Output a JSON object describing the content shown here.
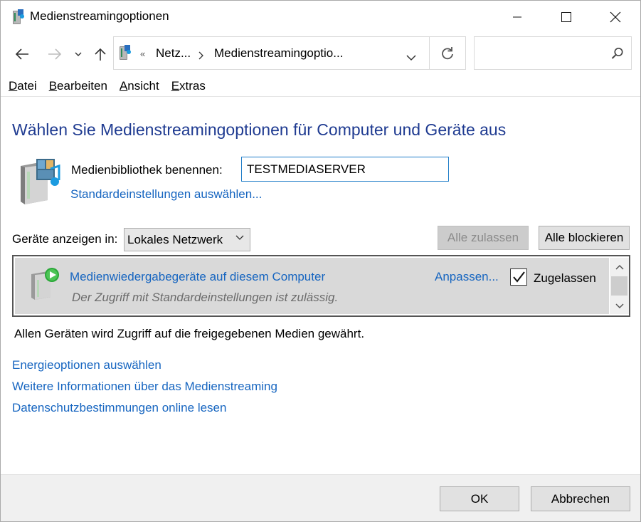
{
  "window": {
    "title": "Medienstreamingoptionen",
    "minimize_icon": "minimize-icon",
    "maximize_icon": "maximize-icon",
    "close_icon": "close-icon"
  },
  "address_bar": {
    "back_icon": "back-arrow-icon",
    "forward_icon": "forward-arrow-icon",
    "up_icon": "up-arrow-icon",
    "overflow": "«",
    "crumbs": [
      "Netz...",
      "Medienstreamingoptio..."
    ],
    "search_placeholder": ""
  },
  "menu": {
    "items": [
      {
        "accel": "D",
        "rest": "atei"
      },
      {
        "accel": "B",
        "rest": "earbeiten"
      },
      {
        "accel": "A",
        "rest": "nsicht"
      },
      {
        "accel": "E",
        "rest": "xtras"
      }
    ]
  },
  "heading": "Wählen Sie Medienstreamingoptionen für Computer und Geräte aus",
  "library": {
    "label": "Medienbibliothek benennen:",
    "value": "TESTMEDIASERVER",
    "defaults_link": "Standardeinstellungen auswählen..."
  },
  "devices": {
    "show_label": "Geräte anzeigen in:",
    "selected_network": "Lokales Netzwerk",
    "allow_all": "Alle zulassen",
    "block_all": "Alle blockieren",
    "rows": [
      {
        "title": "Medienwiedergabegeräte auf diesem Computer",
        "description": "Der Zugriff mit Standardeinstellungen ist zulässig.",
        "customize": "Anpassen...",
        "allowed_label": "Zugelassen",
        "allowed": true
      }
    ]
  },
  "info_text": "Allen Geräten wird Zugriff auf die freigegebenen Medien gewährt.",
  "links": {
    "power": "Energieoptionen auswählen",
    "more_info": "Weitere Informationen über das Medienstreaming",
    "privacy": "Datenschutzbestimmungen online lesen"
  },
  "footer": {
    "ok": "OK",
    "cancel": "Abbrechen"
  },
  "colors": {
    "heading": "#1f3b91",
    "link": "#1665c0",
    "row_selected": "#d9d9d9",
    "input_focus": "#1e7cc8"
  }
}
